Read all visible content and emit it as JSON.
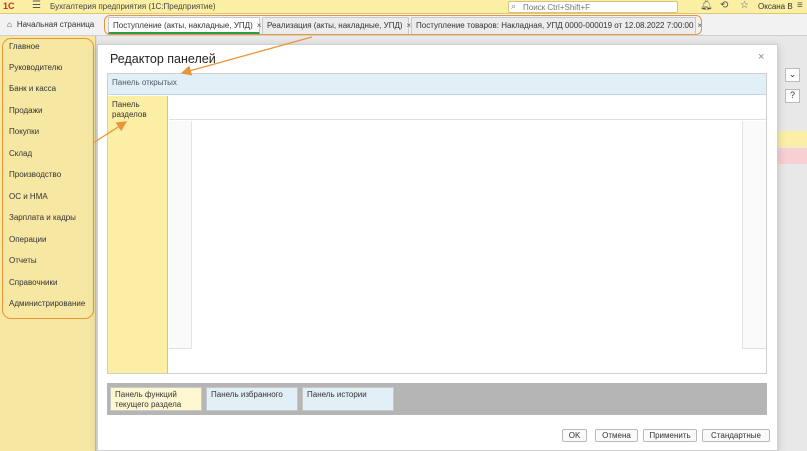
{
  "titlebar": {
    "logo": "1С",
    "app_title": "Бухгалтерия предприятия  (1С:Предприятие)",
    "search_placeholder": "Поиск Ctrl+Shift+F",
    "username": "Оксана В"
  },
  "tabs": {
    "home": "Начальная страница",
    "items": [
      {
        "label": "Поступление (акты, накладные, УПД)"
      },
      {
        "label": "Реализация (акты, накладные, УПД)"
      },
      {
        "label": "Поступление товаров: Накладная, УПД 0000-000019 от 12.08.2022 7:00:00"
      }
    ],
    "close_symbol": "×"
  },
  "sidebar": {
    "items": [
      {
        "label": "Главное"
      },
      {
        "label": "Руководителю"
      },
      {
        "label": "Банк и касса"
      },
      {
        "label": "Продажи"
      },
      {
        "label": "Покупки"
      },
      {
        "label": "Склад"
      },
      {
        "label": "Производство"
      },
      {
        "label": "ОС и НМА"
      },
      {
        "label": "Зарплата и кадры"
      },
      {
        "label": "Операции"
      },
      {
        "label": "Отчеты"
      },
      {
        "label": "Справочники"
      },
      {
        "label": "Администрирование"
      }
    ]
  },
  "background": {
    "help_button": "?"
  },
  "modal": {
    "title": "Редактор панелей",
    "close_symbol": "×",
    "open_panel_label": "Панель открытых",
    "sections_panel_label": "Панель разделов",
    "bottom_panels": [
      {
        "label": "Панель функций текущего раздела"
      },
      {
        "label": "Панель избранного"
      },
      {
        "label": "Панель истории"
      }
    ],
    "buttons": {
      "ok": "OK",
      "cancel": "Отмена",
      "apply": "Применить",
      "standard": "Стандартные"
    }
  },
  "colors": {
    "accent_orange": "#e8963a",
    "sidebar_yellow": "#f6e7a3",
    "open_panel_blue": "#e1eff7",
    "active_tab_green": "#2f9a4b"
  },
  "icons": [
    "menu-icon",
    "search-icon",
    "bell-icon",
    "history-icon",
    "star-icon",
    "home-icon",
    "close-icon"
  ]
}
